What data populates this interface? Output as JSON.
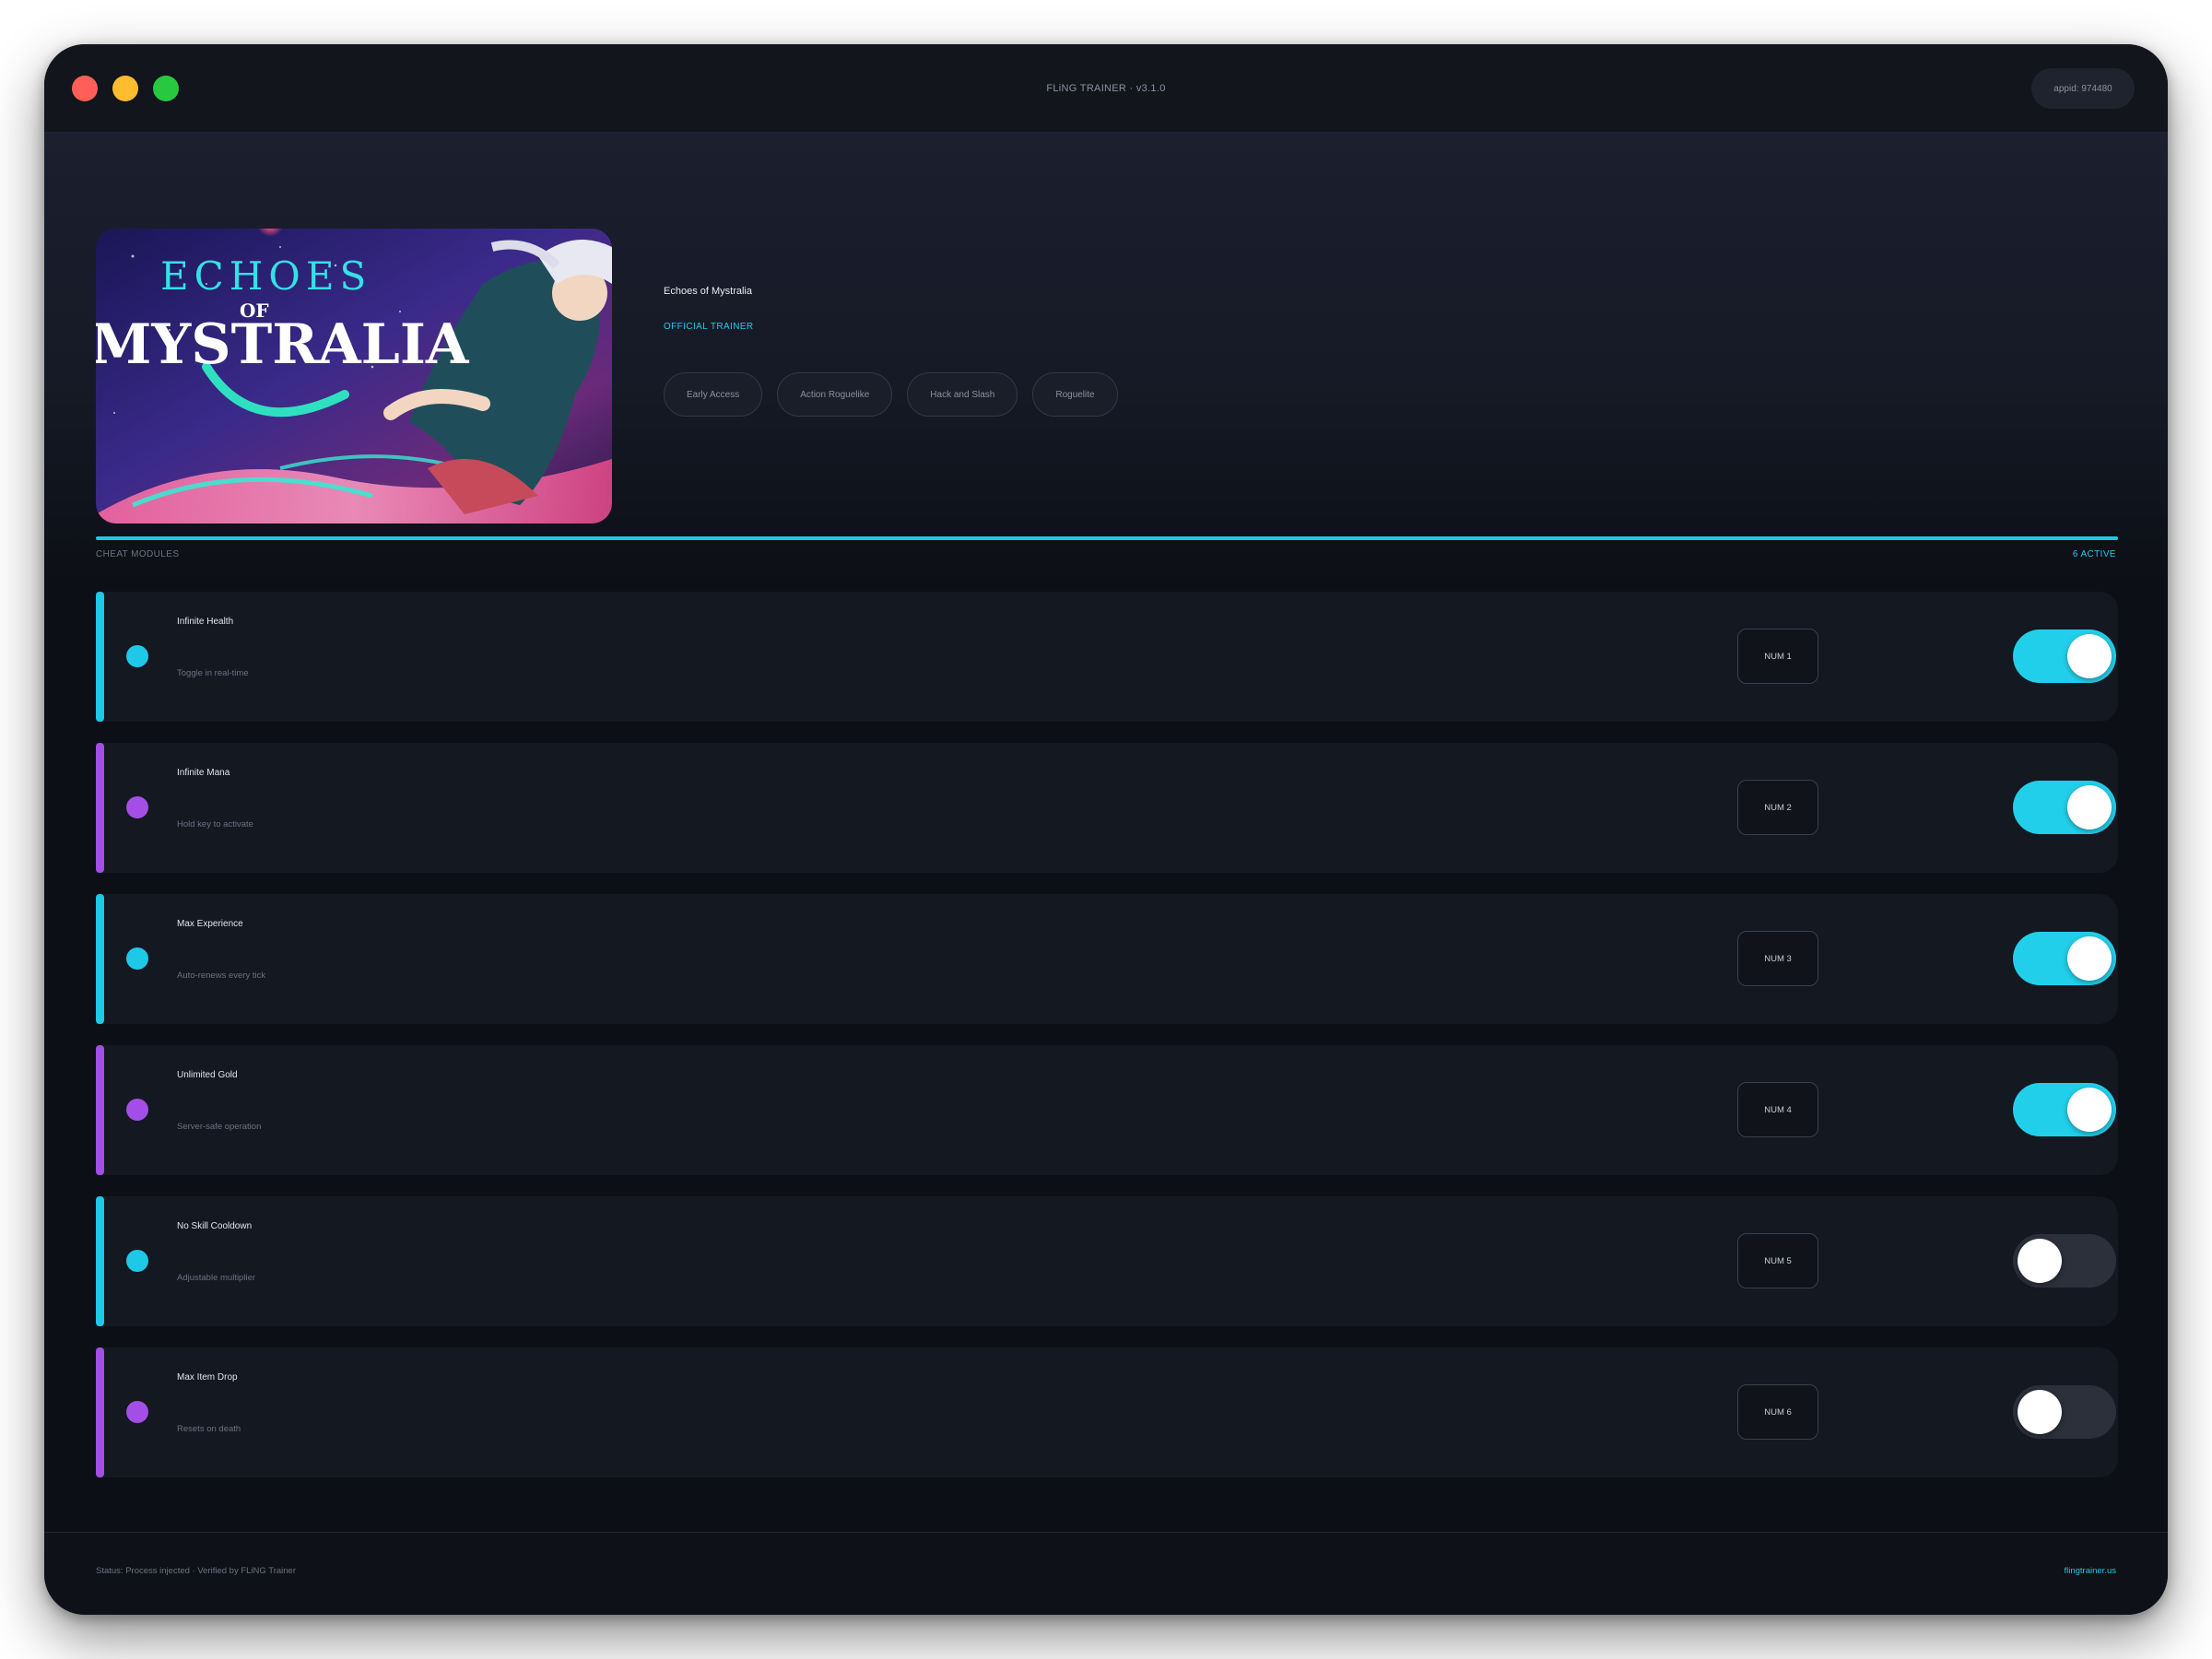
{
  "window": {
    "title": "FLiNG TRAINER · v3.1.0",
    "appid": "appid: 974480"
  },
  "game": {
    "title": "Echoes of Mystralia",
    "trainer_label": "OFFICIAL TRAINER",
    "cover_text": {
      "line1": "ECHOES",
      "line2": "OF",
      "line3": "MYSTRALIA"
    },
    "tags": [
      "Early Access",
      "Action Roguelike",
      "Hack and Slash",
      "Roguelite"
    ]
  },
  "modules": {
    "heading": "CHEAT MODULES",
    "active_count": "6 ACTIVE",
    "items": [
      {
        "name": "Infinite Health",
        "desc": "Toggle in real-time",
        "hotkey": "NUM 1",
        "enabled": true,
        "accent": "#1ec9e8"
      },
      {
        "name": "Infinite Mana",
        "desc": "Hold key to activate",
        "hotkey": "NUM 2",
        "enabled": true,
        "accent": "#a34ee6"
      },
      {
        "name": "Max Experience",
        "desc": "Auto-renews every tick",
        "hotkey": "NUM 3",
        "enabled": true,
        "accent": "#1ec9e8"
      },
      {
        "name": "Unlimited Gold",
        "desc": "Server-safe operation",
        "hotkey": "NUM 4",
        "enabled": true,
        "accent": "#a34ee6"
      },
      {
        "name": "No Skill Cooldown",
        "desc": "Adjustable multiplier",
        "hotkey": "NUM 5",
        "enabled": false,
        "accent": "#1ec9e8"
      },
      {
        "name": "Max Item Drop",
        "desc": "Resets on death",
        "hotkey": "NUM 6",
        "enabled": false,
        "accent": "#a34ee6"
      }
    ]
  },
  "footer": {
    "status": "Status: Process injected · Verified by FLiNG Trainer",
    "link": "flingtrainer.us"
  },
  "colors": {
    "accent_cyan": "#1ec9e8",
    "accent_purple": "#a34ee6",
    "toggle_on": "#22cfea",
    "toggle_off": "#2c303b"
  }
}
